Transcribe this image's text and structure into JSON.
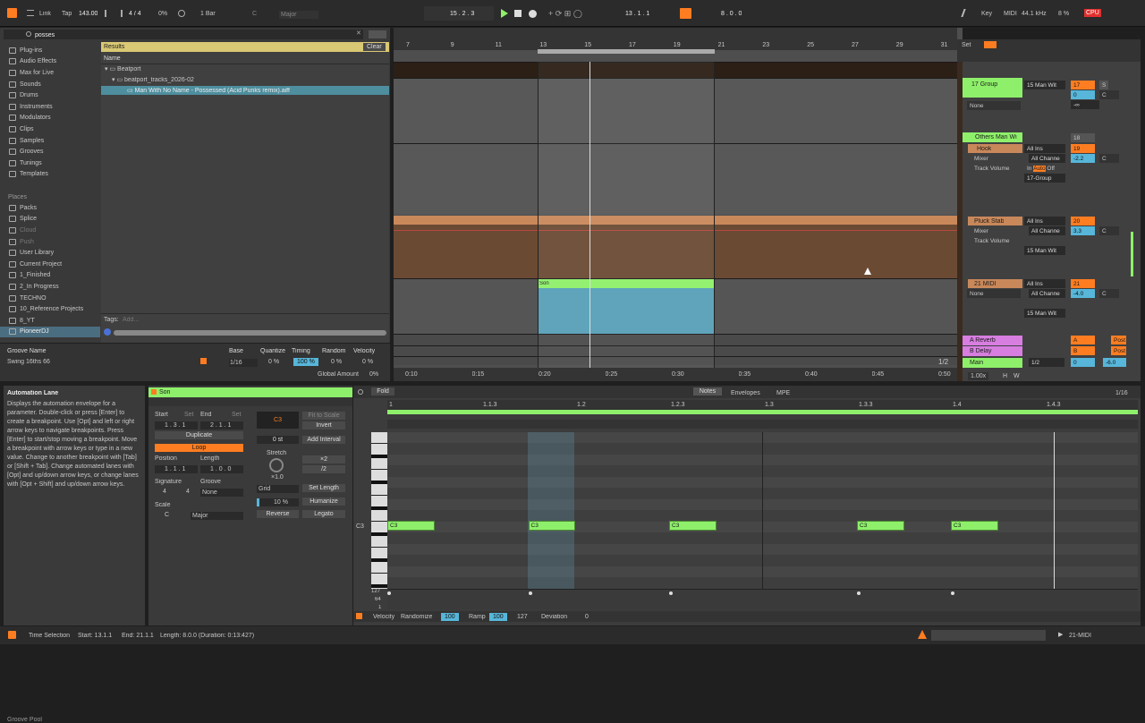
{
  "transport": {
    "link": "Link",
    "tap": "Tap",
    "tempo": "143.00",
    "time_signature": "4 / 4",
    "swing": "0%",
    "quantize": "1 Bar",
    "key_root": "C",
    "scale": "Major",
    "arrangement_position": "15 . 2 . 3",
    "loop_start": "13 . 1 . 1",
    "loop_length": "8 . 0 . 0",
    "key_label": "Key",
    "midi_label": "MIDI",
    "sample_rate": "44.1 kHz",
    "cpu_percent": "8 %",
    "cpu_label": "CPU"
  },
  "browser": {
    "search_value": "posses",
    "categories": [
      "Plug-ins",
      "Audio Effects",
      "Max for Live",
      "Sounds",
      "Drums",
      "Instruments",
      "Modulators",
      "Clips",
      "Samples",
      "Grooves",
      "Tunings",
      "Templates"
    ],
    "places_label": "Places",
    "places": [
      "Packs",
      "Splice",
      "Cloud",
      "Push",
      "User Library",
      "Current Project",
      "1_Finished",
      "2_In Progress",
      "TECHNO",
      "10_Reference Projects",
      "8_YT",
      "PioneerDJ"
    ],
    "results_label": "Results",
    "clear_label": "Clear",
    "name_header": "Name",
    "tree": [
      "Beatport",
      "beatport_tracks_2026-02",
      "Man With No Name - Possessed (Acid Punks remix).aiff"
    ],
    "tags_label": "Tags:",
    "tags_add": "Add..."
  },
  "groove_pool": {
    "headers": [
      "Groove Name",
      "Base",
      "Quantize",
      "Timing",
      "Random",
      "Velocity"
    ],
    "name": "Swing 16ths 66",
    "base": "1/16",
    "quantize": "0 %",
    "timing": "100 %",
    "random": "0 %",
    "velocity": "0 %",
    "global_amount_label": "Global Amount",
    "global_amount": "0%",
    "title": "Groove Pool"
  },
  "info_view": {
    "title": "Automation Lane",
    "body": "Displays the automation envelope for a parameter. Double-click or press [Enter] to create a breakpoint. Use [Opt] and left or right arrow keys to navigate breakpoints. Press [Enter] to start/stop moving a breakpoint. Move a breakpoint with arrow keys or type in a new value. Change to another breakpoint with [Tab] or [Shift + Tab]. Change automated lanes with [Opt] and up/down arrow keys, or change lanes with [Opt + Shift] and up/down arrow keys."
  },
  "arrangement": {
    "bar_numbers": [
      "7",
      "9",
      "11",
      "13",
      "15",
      "17",
      "19",
      "21",
      "23",
      "25",
      "27",
      "29",
      "31"
    ],
    "time_labels": [
      "0:10",
      "0:15",
      "0:20",
      "0:25",
      "0:30",
      "0:35",
      "0:40",
      "0:45",
      "0:50"
    ],
    "clip_name": "Son",
    "page_indicator": "1/2",
    "zoom": "1.00x",
    "set_label": "Set"
  },
  "mixer": {
    "tracks": [
      {
        "name": "17 Group",
        "input": "15 Man Wit",
        "number": "17",
        "volume": "0",
        "pan": "C",
        "sends": "-∞",
        "color": "#8ef06a",
        "routing": "None"
      },
      {
        "name": "Others Man Wi",
        "number": "18",
        "color": "#8ef06a"
      },
      {
        "name": "Hook",
        "input": "All Ins",
        "channel": "All Channe",
        "number": "19",
        "volume": "-2.2",
        "pan": "C",
        "color": "#c9885a",
        "device": "Mixer",
        "param": "Track Volume",
        "output": "17-Group"
      },
      {
        "name": "Pluck Stab",
        "input": "All Ins",
        "channel": "All Channe",
        "number": "20",
        "volume": "3.3",
        "pan": "C",
        "color": "#c9885a",
        "device": "Mixer",
        "param": "Track Volume",
        "output": "15 Man Wit"
      },
      {
        "name": "21 MIDI",
        "input": "All Ins",
        "channel": "All Channe",
        "number": "21",
        "volume": "-4.0",
        "pan": "C",
        "color": "#c9885a",
        "routing": "None",
        "output": "15 Man Wit"
      },
      {
        "name": "A Reverb",
        "letter": "A",
        "color": "#d77ee0"
      },
      {
        "name": "B Delay",
        "letter": "B",
        "color": "#d77ee0"
      },
      {
        "name": "Main",
        "volume": "0",
        "master_vol": "-6.0",
        "cue": "1/2",
        "color": "#8ef06a"
      }
    ],
    "monitor_in": "In",
    "monitor_auto": "Auto",
    "monitor_off": "Off",
    "solo": "S",
    "post": "Post",
    "h_label": "H",
    "w_label": "W"
  },
  "clip_view": {
    "clip_name": "Son",
    "start_label": "Start",
    "end_label": "End",
    "set_label": "Set",
    "start_value": "1 . 3 . 1",
    "end_value": "2 . 1 . 1",
    "duplicate": "Duplicate",
    "loop": "Loop",
    "position_label": "Position",
    "length_label": "Length",
    "position_value": "1 . 1 . 1",
    "length_value": "1 . 0 . 0",
    "signature_label": "Signature",
    "groove_label": "Groove",
    "sig_num": "4",
    "sig_den": "4",
    "groove_value": "None",
    "scale_label": "Scale",
    "scale_root": "C",
    "scale_name": "Major",
    "note_box": "C3",
    "fit_to_scale": "Fit to Scale",
    "invert": "Invert",
    "transpose": "0 st",
    "add_interval": "Add Interval",
    "stretch_label": "Stretch",
    "stretch_value": "×1.0",
    "times2": "×2",
    "div2": "/2",
    "grid": "Grid",
    "set_length": "Set Length",
    "humanize_amt": "10 %",
    "humanize": "Humanize",
    "reverse": "Reverse",
    "legato": "Legato",
    "fold": "Fold",
    "tabs": [
      "Notes",
      "Envelopes",
      "MPE"
    ],
    "grid_value": "1/16"
  },
  "piano_roll": {
    "bar_labels": [
      "1",
      "1.1.3",
      "1.2",
      "1.2.3",
      "1.3",
      "1.3.3",
      "1.4",
      "1.4.3"
    ],
    "row_label": "C3",
    "notes": [
      {
        "label": "C3",
        "start": 0,
        "length": 0.5
      },
      {
        "label": "C3",
        "start": 1.5,
        "length": 0.5
      },
      {
        "label": "C3",
        "start": 3,
        "length": 0.5
      },
      {
        "label": "C3",
        "start": 5,
        "length": 0.5
      },
      {
        "label": "C3",
        "start": 6,
        "length": 0.5
      }
    ],
    "velocity_scale": [
      "127",
      "64",
      "1"
    ],
    "velocity_label": "Velocity",
    "randomize": "Randomize",
    "rand_val": "100",
    "ramp": "Ramp",
    "ramp_val": "100",
    "ramp_end": "127",
    "deviation": "Deviation",
    "deviation_val": "0"
  },
  "status_bar": {
    "mode": "Time Selection",
    "start": "Start: 13.1.1",
    "end": "End: 21.1.1",
    "length": "Length: 8.0.0 (Duration: 0:13:427)",
    "track": "21-MIDI"
  },
  "colors": {
    "accent": "#ff7d21",
    "clip_green": "#8ef06a",
    "selection_blue": "#57b6d9",
    "audio_brown": "#6b4a33"
  }
}
